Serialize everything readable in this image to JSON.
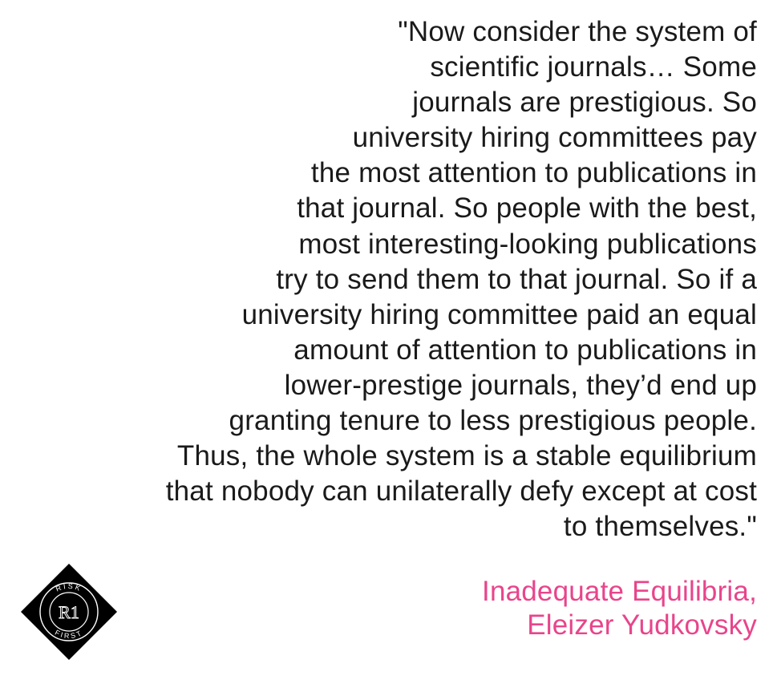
{
  "quote": {
    "lines": [
      "\"Now consider the system of",
      "scientific journals… Some",
      "journals are prestigious. So",
      "university hiring committees pay",
      "the most attention to publications in",
      "that journal. So people with the best,",
      "most interesting-looking publications",
      "try to send them to that journal. So if a",
      "university hiring committee paid an equal",
      "amount of attention to publications in",
      "lower-prestige journals, they’d end up",
      "granting tenure to less prestigious people.",
      "Thus, the whole system is a stable equilibrium",
      "that nobody can unilaterally defy except at cost",
      "to themselves.\""
    ]
  },
  "attribution": {
    "lines": [
      "Inadequate Equilibria,",
      "Eleizer Yudkovsky"
    ],
    "color": "#e8458b"
  },
  "logo": {
    "top_text": "RISK",
    "bottom_text": "FIRST",
    "monogram": "R1",
    "icon": "risk-first-logo-icon"
  },
  "colors": {
    "background": "#ffffff",
    "text": "#1a1a1a",
    "accent": "#e8458b"
  }
}
